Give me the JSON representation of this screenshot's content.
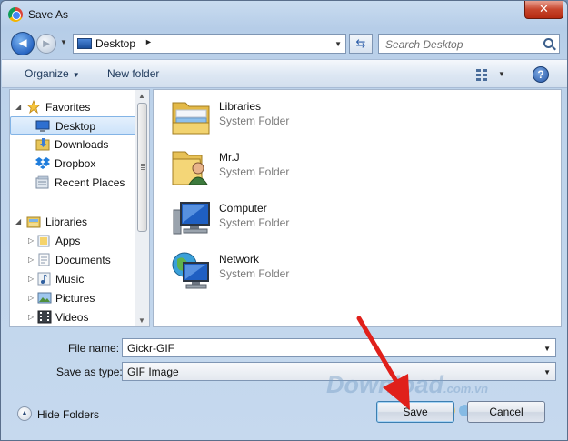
{
  "window": {
    "title": "Save As",
    "close_label": "✕"
  },
  "address_bar": {
    "location": "Desktop",
    "search_placeholder": "Search Desktop"
  },
  "toolbar": {
    "organize_label": "Organize",
    "new_folder_label": "New folder",
    "help_label": "?"
  },
  "nav_pane": {
    "favorites": {
      "label": "Favorites",
      "items": [
        {
          "label": "Desktop",
          "icon": "desktop-icon",
          "selected": true
        },
        {
          "label": "Downloads",
          "icon": "downloads-folder-icon"
        },
        {
          "label": "Dropbox",
          "icon": "dropbox-icon"
        },
        {
          "label": "Recent Places",
          "icon": "recent-places-icon"
        }
      ]
    },
    "libraries": {
      "label": "Libraries",
      "items": [
        {
          "label": "Apps",
          "icon": "folder-icon"
        },
        {
          "label": "Documents",
          "icon": "documents-icon"
        },
        {
          "label": "Music",
          "icon": "music-icon"
        },
        {
          "label": "Pictures",
          "icon": "pictures-icon"
        },
        {
          "label": "Videos",
          "icon": "videos-icon"
        }
      ]
    }
  },
  "file_pane": {
    "items": [
      {
        "name": "Libraries",
        "type": "System Folder",
        "icon": "libraries-icon"
      },
      {
        "name": "Mr.J",
        "type": "System Folder",
        "icon": "user-folder-icon"
      },
      {
        "name": "Computer",
        "type": "System Folder",
        "icon": "computer-icon"
      },
      {
        "name": "Network",
        "type": "System Folder",
        "icon": "network-icon"
      }
    ]
  },
  "form": {
    "file_name_label": "File name:",
    "file_name_value": "Gickr-GIF",
    "save_type_label": "Save as type:",
    "save_type_value": "GIF Image"
  },
  "footer": {
    "hide_folders_label": "Hide Folders",
    "save_label": "Save",
    "cancel_label": "Cancel"
  },
  "watermark": {
    "text": "Download",
    "suffix": ".com.vn"
  },
  "colors": {
    "accent": "#2a67c4",
    "arrow": "#e0201b",
    "selection": "#cde3fa"
  }
}
